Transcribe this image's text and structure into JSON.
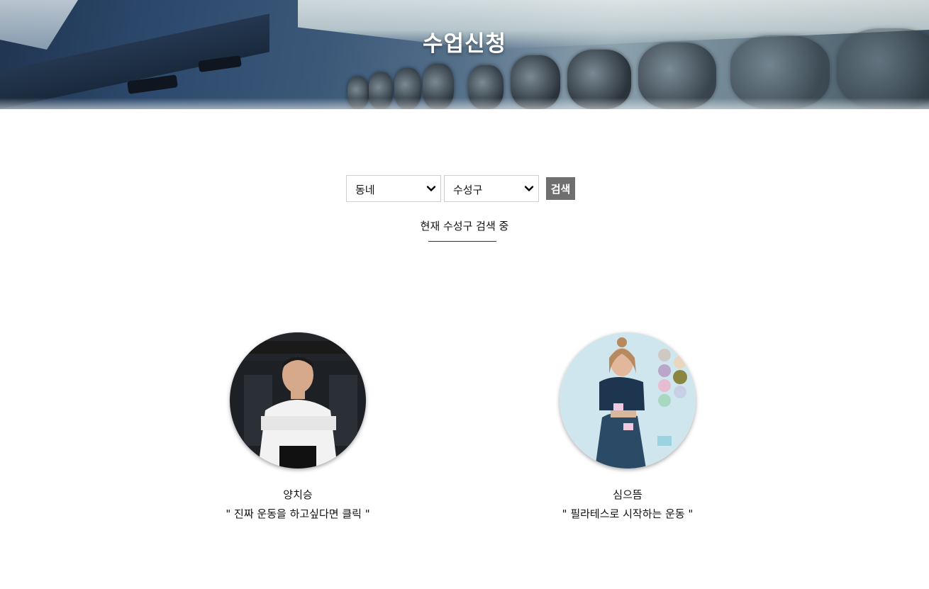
{
  "hero": {
    "title": "수업신청"
  },
  "filters": {
    "neighborhood_select": {
      "selected": "동네"
    },
    "district_select": {
      "selected": "수성구"
    },
    "search_button_label": "검색"
  },
  "status_text": "현재 수성구 검색 중",
  "trainers": [
    {
      "name": "양치승",
      "tagline": "\" 진짜 운동을 하고싶다면 클릭 \""
    },
    {
      "name": "심으뜸",
      "tagline": "\" 필라테스로 시작하는 운동 \""
    }
  ],
  "colors": {
    "search_button_bg": "#6f6f6f",
    "page_bg": "#ffffff"
  }
}
